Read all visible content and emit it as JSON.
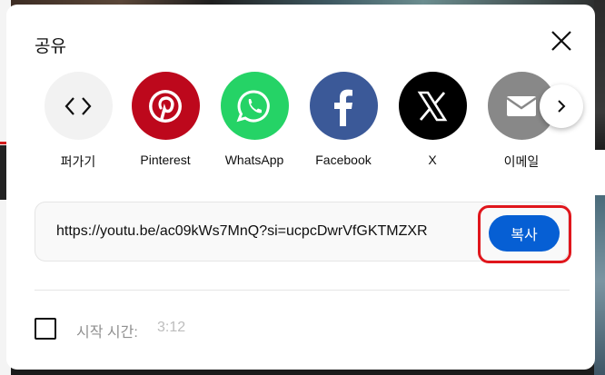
{
  "dialog": {
    "title": "공유",
    "close_icon": "close-icon"
  },
  "share_targets": [
    {
      "label": "퍼가기",
      "icon": "embed-icon",
      "color": "#f2f2f2"
    },
    {
      "label": "Pinterest",
      "icon": "pinterest-icon",
      "color": "#bd081c"
    },
    {
      "label": "WhatsApp",
      "icon": "whatsapp-icon",
      "color": "#25d366"
    },
    {
      "label": "Facebook",
      "icon": "facebook-icon",
      "color": "#3b5998"
    },
    {
      "label": "X",
      "icon": "x-icon",
      "color": "#000000"
    },
    {
      "label": "이메일",
      "icon": "email-icon",
      "color": "#888888"
    }
  ],
  "next_icon": "chevron-right-icon",
  "link": {
    "url": "https://youtu.be/ac09kWs7MnQ?si=ucpcDwrVfGKTMZXR",
    "copy_label": "복사",
    "copy_color": "#065fd4",
    "highlight_color": "#e0161c"
  },
  "start_at": {
    "label": "시작 시간:",
    "time": "3:12",
    "checked": false
  }
}
